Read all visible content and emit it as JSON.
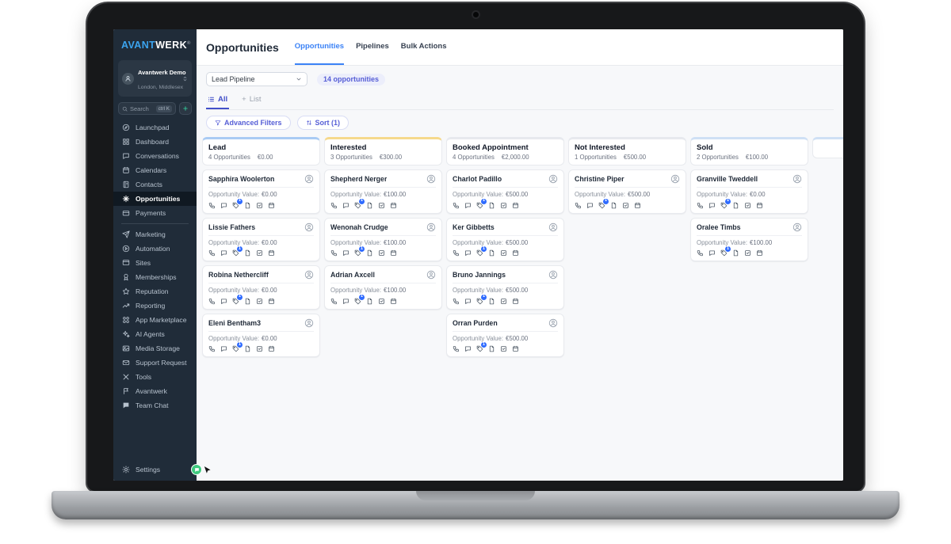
{
  "brand": {
    "name_primary": "AVANT",
    "name_secondary": "WERK",
    "trademark": "®"
  },
  "account": {
    "name": "Avantwerk Demo",
    "location": "London, Middlesex"
  },
  "search": {
    "placeholder": "Search",
    "shortcut": "ctrl K",
    "add_button": "+"
  },
  "sidebar": {
    "items": [
      {
        "label": "Launchpad",
        "icon": "launchpad-icon"
      },
      {
        "label": "Dashboard",
        "icon": "dashboard-icon"
      },
      {
        "label": "Conversations",
        "icon": "conversations-icon"
      },
      {
        "label": "Calendars",
        "icon": "calendars-icon"
      },
      {
        "label": "Contacts",
        "icon": "contacts-icon"
      },
      {
        "label": "Opportunities",
        "icon": "opportunities-icon",
        "active": true
      },
      {
        "label": "Payments",
        "icon": "payments-icon",
        "divider_after": true
      },
      {
        "label": "Marketing",
        "icon": "marketing-icon"
      },
      {
        "label": "Automation",
        "icon": "automation-icon"
      },
      {
        "label": "Sites",
        "icon": "sites-icon"
      },
      {
        "label": "Memberships",
        "icon": "memberships-icon"
      },
      {
        "label": "Reputation",
        "icon": "reputation-icon"
      },
      {
        "label": "Reporting",
        "icon": "reporting-icon"
      },
      {
        "label": "App Marketplace",
        "icon": "marketplace-icon"
      },
      {
        "label": "AI Agents",
        "icon": "ai-agents-icon"
      },
      {
        "label": "Media Storage",
        "icon": "media-icon"
      },
      {
        "label": "Support Request",
        "icon": "support-icon"
      },
      {
        "label": "Tools",
        "icon": "tools-icon"
      },
      {
        "label": "Avantwerk",
        "icon": "avantwerk-icon"
      },
      {
        "label": "Team Chat",
        "icon": "team-chat-icon"
      }
    ],
    "footer_item": {
      "label": "Settings",
      "icon": "settings-icon"
    }
  },
  "header": {
    "title": "Opportunities",
    "tabs": [
      {
        "label": "Opportunities",
        "active": true
      },
      {
        "label": "Pipelines",
        "active": false
      },
      {
        "label": "Bulk Actions",
        "active": false
      }
    ]
  },
  "toolbar": {
    "pipeline_selected": "Lead Pipeline",
    "opportunity_count": "14 opportunities",
    "view_tabs": [
      {
        "label": "All",
        "icon": "list-icon",
        "active": true
      },
      {
        "label": "List",
        "prefix": "+",
        "active": false
      }
    ],
    "advanced_filters_label": "Advanced Filters",
    "sort_label": "Sort (1)"
  },
  "board": {
    "value_label": "Opportunity Value:",
    "card_icons": [
      "phone-icon",
      "message-icon",
      "tag-icon",
      "file-icon",
      "task-icon",
      "calendar-icon"
    ],
    "tag_badge_count": "1",
    "partial_column_accent": "#cfe0f5",
    "columns": [
      {
        "title": "Lead",
        "count": "4 Opportunities",
        "total": "€0.00",
        "accent": "#a9cbf4",
        "cards": [
          {
            "name": "Sapphira Woolerton",
            "value": "€0.00"
          },
          {
            "name": "Lissie Fathers",
            "value": "€0.00"
          },
          {
            "name": "Robina Nethercliff",
            "value": "€0.00"
          },
          {
            "name": "Eleni Bentham3",
            "value": "€0.00"
          }
        ]
      },
      {
        "title": "Interested",
        "count": "3 Opportunities",
        "total": "€300.00",
        "accent": "#f6d98c",
        "cards": [
          {
            "name": "Shepherd Nerger",
            "value": "€100.00"
          },
          {
            "name": "Wenonah Crudge",
            "value": "€100.00"
          },
          {
            "name": "Adrian Axcell",
            "value": "€100.00"
          }
        ]
      },
      {
        "title": "Booked Appointment",
        "count": "4 Opportunities",
        "total": "€2,000.00",
        "accent": "#e7e9ee",
        "cards": [
          {
            "name": "Charlot Padillo",
            "value": "€500.00"
          },
          {
            "name": "Ker Gibbetts",
            "value": "€500.00"
          },
          {
            "name": "Bruno Jannings",
            "value": "€500.00"
          },
          {
            "name": "Orran Purden",
            "value": "€500.00"
          }
        ]
      },
      {
        "title": "Not Interested",
        "count": "1 Opportunities",
        "total": "€500.00",
        "accent": "#e7e9ee",
        "cards": [
          {
            "name": "Christine Piper",
            "value": "€500.00"
          }
        ]
      },
      {
        "title": "Sold",
        "count": "2 Opportunities",
        "total": "€100.00",
        "accent": "#cfe0f5",
        "cards": [
          {
            "name": "Granville Tweddell",
            "value": "€0.00"
          },
          {
            "name": "Oralee Timbs",
            "value": "€100.00"
          }
        ]
      }
    ]
  },
  "colors": {
    "accent_blue": "#3b82f6",
    "accent_indigo": "#565ed6",
    "sidebar_bg": "#202c39",
    "badge_blue": "#2f6bff",
    "widget_green": "#3fca7f"
  }
}
